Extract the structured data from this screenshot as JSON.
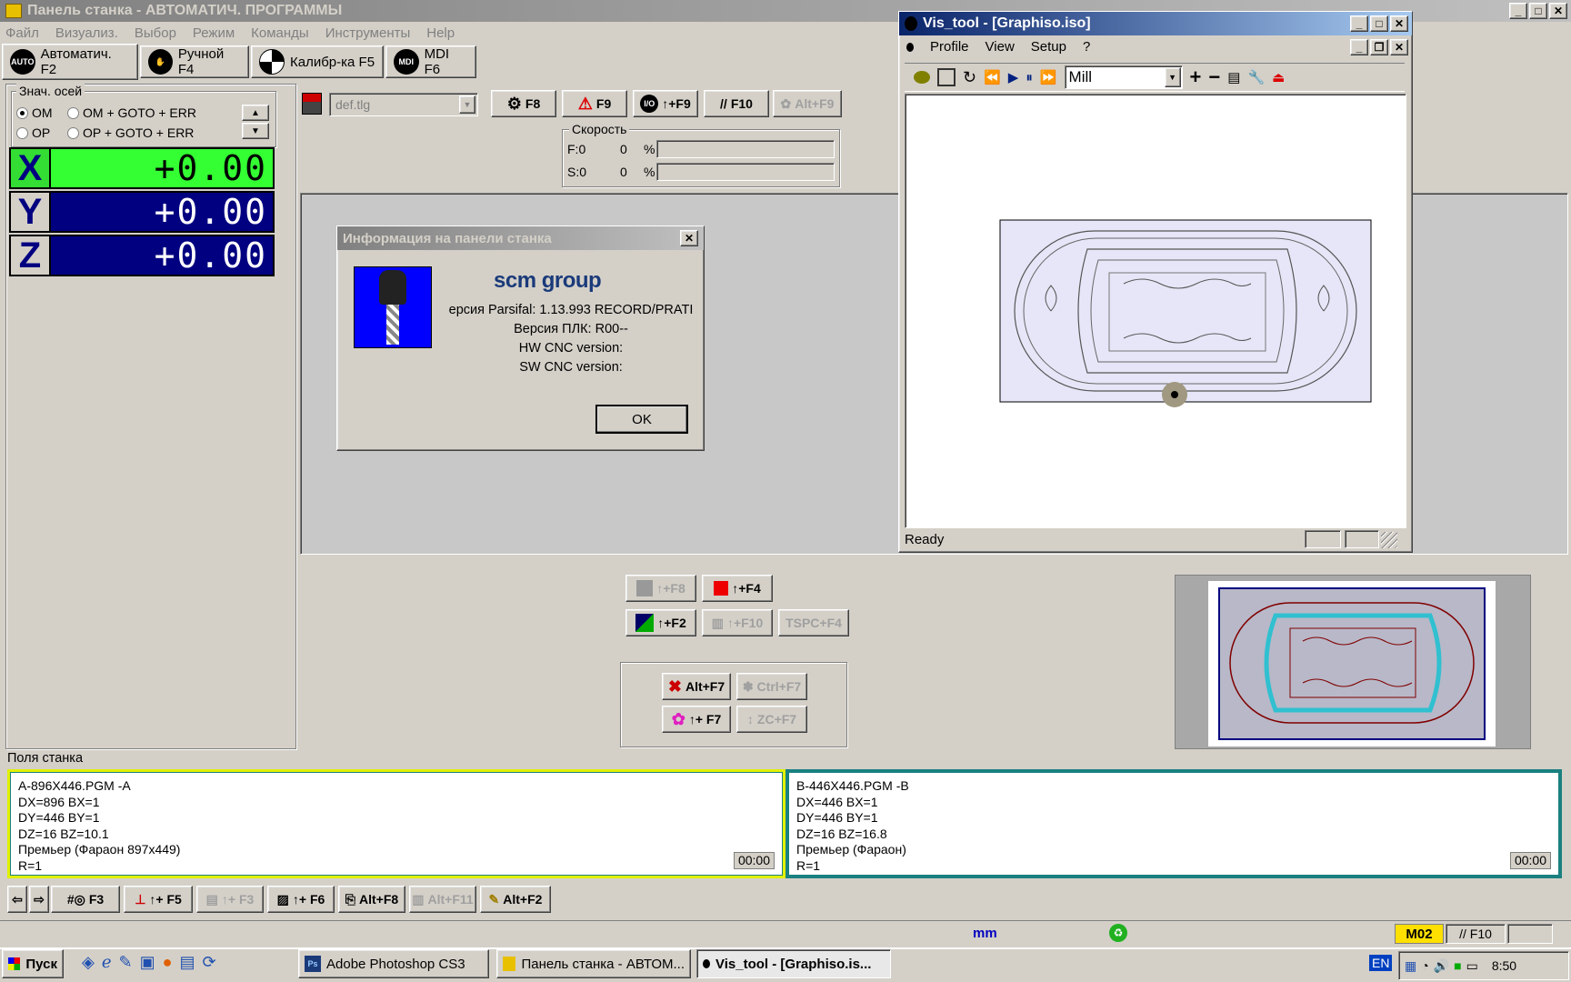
{
  "main_window": {
    "title": "Панель станка - АВТОМАТИЧ. ПРОГРАММЫ",
    "menu": [
      "Файл",
      "Визуализ.",
      "Выбор",
      "Режим",
      "Команды",
      "Инструменты",
      "Help"
    ],
    "tabs": [
      {
        "icon": "AUTO",
        "label": "Автоматич. F2"
      },
      {
        "icon": "hand-icon",
        "label": "Ручной F4"
      },
      {
        "icon": "calibration-icon",
        "label": "Калибр-ка  F5"
      },
      {
        "icon": "MDI",
        "label": "MDI F6"
      }
    ]
  },
  "axes_group": {
    "title": "Знач. осей",
    "options": [
      "OM",
      "OM + GOTO + ERR",
      "OP",
      "OP + GOTO + ERR"
    ],
    "selected": "OM"
  },
  "dro": [
    {
      "axis": "X",
      "value": "+0.00",
      "color": "#33ff33"
    },
    {
      "axis": "Y",
      "value": "+0.00",
      "color": "#000080"
    },
    {
      "axis": "Z",
      "value": "+0.00",
      "color": "#000080"
    }
  ],
  "toolbar": {
    "tool_file": "def.tlg",
    "buttons": [
      {
        "label": "F8",
        "icon": "gear-icon"
      },
      {
        "label": "F9",
        "icon": "warning-icon"
      },
      {
        "label": "↑+F9",
        "icon": "io-icon"
      },
      {
        "label": "F10",
        "icon": "slash-icon"
      },
      {
        "label": "Alt+F9",
        "icon": "group-icon",
        "disabled": true
      }
    ]
  },
  "speed": {
    "title": "Скорость",
    "f_label": "F:0",
    "f_value": "0",
    "s_label": "S:0",
    "s_value": "0",
    "unit": "%"
  },
  "dialog": {
    "title": "Информация на панели станка",
    "logo": "scm group",
    "lines": [
      "ерсия Parsifal: 1.13.993 RECORD/PRATI",
      "Версия ПЛК: R00--",
      "HW CNC version:",
      "SW CNC version:"
    ],
    "ok": "OK"
  },
  "vis_tool": {
    "title": "Vis_tool - [Graphiso.iso]",
    "menu": [
      "Profile",
      "View",
      "Setup",
      "?"
    ],
    "mode": "Mill",
    "status": "Ready"
  },
  "mid_buttons": [
    {
      "label": "↑+F8",
      "disabled": true
    },
    {
      "label": "↑+F4",
      "disabled": false
    },
    {
      "label": "↑+F2",
      "disabled": false
    },
    {
      "label": "↑+F10",
      "disabled": true
    },
    {
      "label": "TSPC+F4",
      "disabled": true
    }
  ],
  "lower_buttons": [
    {
      "label": "Alt+F7",
      "disabled": false
    },
    {
      "label": "Ctrl+F7",
      "disabled": true
    },
    {
      "label": "↑+ F7",
      "disabled": false
    },
    {
      "label": "ZC+F7",
      "disabled": true
    }
  ],
  "fields_label": "Поля станка",
  "field_a": {
    "lines": [
      "A-896X446.PGM  -A",
      "DX=896 BX=1",
      "DY=446 BY=1",
      "DZ=16 BZ=10.1",
      "Премьер (Фараон 897x449)",
      "R=1"
    ],
    "time": "00:00"
  },
  "field_b": {
    "lines": [
      "B-446X446.PGM  -B",
      "DX=446 BX=1",
      "DY=446 BY=1",
      "DZ=16 BZ=16.8",
      "Премьер (Фараон)",
      "R=1"
    ],
    "time": "00:00"
  },
  "bottom_toolbar": [
    "F3",
    "↑+ F5",
    "↑+ F3",
    "↑+ F6",
    "Alt+F8",
    "Alt+F11",
    "Alt+F2"
  ],
  "statusbar": {
    "unit": "mm",
    "mode": "M02",
    "f10": "// F10"
  },
  "taskbar": {
    "start": "Пуск",
    "items": [
      "Adobe Photoshop CS3",
      "Панель станка - АВТОМ...",
      "Vis_tool - [Graphiso.is..."
    ],
    "lang": "EN",
    "clock": "8:50"
  }
}
